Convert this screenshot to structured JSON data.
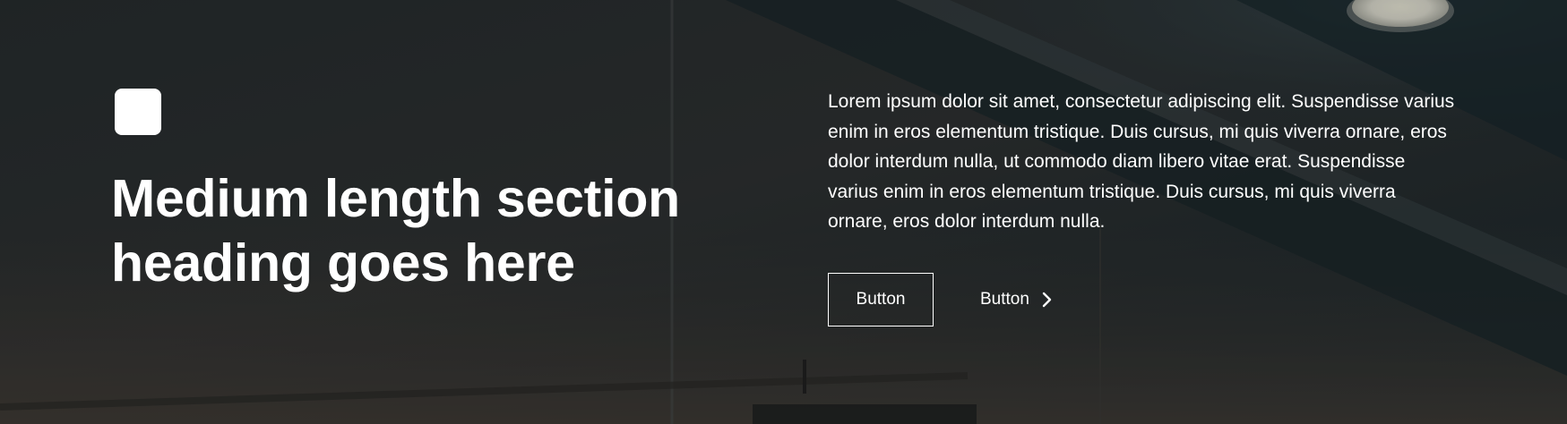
{
  "section": {
    "heading": "Medium length section heading goes here",
    "body": "Lorem ipsum dolor sit amet, consectetur adipiscing elit. Suspendisse varius enim in eros elementum tristique. Duis cursus, mi quis viverra ornare, eros dolor interdum nulla, ut commodo diam libero vitae erat. Suspendisse varius enim in eros elementum tristique. Duis cursus, mi quis viverra ornare, eros dolor interdum nulla.",
    "primary_button_label": "Button",
    "secondary_button_label": "Button"
  },
  "icons": {
    "logo": "square-logo-icon",
    "secondary_button_icon": "chevron-right-icon"
  },
  "colors": {
    "text": "#ffffff",
    "overlay": "#1c2529"
  }
}
